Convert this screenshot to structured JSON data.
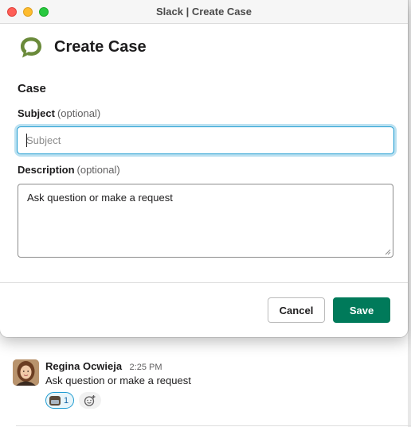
{
  "window": {
    "title": "Slack | Create Case"
  },
  "modal": {
    "title": "Create Case",
    "logo_icon": "chat-bubble-logo-icon",
    "section_heading": "Case",
    "subject": {
      "label": "Subject",
      "optional_note": "(optional)",
      "placeholder": "Subject",
      "value": ""
    },
    "description": {
      "label": "Description",
      "optional_note": "(optional)",
      "value": "Ask question or make a request"
    },
    "buttons": {
      "cancel_label": "Cancel",
      "save_label": "Save"
    }
  },
  "message": {
    "author": "Regina Ocwieja",
    "time": "2:25 PM",
    "text": "Ask question or make a request",
    "reaction": {
      "emoji_icon": "laptop-emoji-icon",
      "count": "1"
    },
    "add_reaction_icon": "add-reaction-icon"
  },
  "colors": {
    "save_button": "#007a5a",
    "focus_ring": "#1d9bd1",
    "logo_green": "#6a8a3a",
    "close_light": "#ff5f57",
    "minimize_light": "#febc2e",
    "maximize_light": "#28c840"
  }
}
